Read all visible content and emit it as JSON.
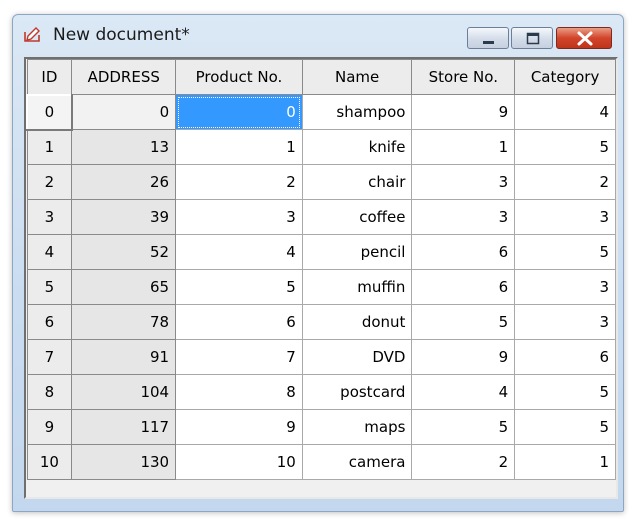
{
  "window": {
    "title": "New document*",
    "controls": {
      "minimize": "minimize",
      "maximize": "maximize",
      "close": "close"
    }
  },
  "table": {
    "columns": [
      "ID",
      "ADDRESS",
      "Product No.",
      "Name",
      "Store No.",
      "Category"
    ],
    "rows": [
      [
        "0",
        "0",
        "0",
        "shampoo",
        "9",
        "4"
      ],
      [
        "1",
        "13",
        "1",
        "knife",
        "1",
        "5"
      ],
      [
        "2",
        "26",
        "2",
        "chair",
        "3",
        "2"
      ],
      [
        "3",
        "39",
        "3",
        "coffee",
        "3",
        "3"
      ],
      [
        "4",
        "52",
        "4",
        "pencil",
        "6",
        "5"
      ],
      [
        "5",
        "65",
        "5",
        "muffin",
        "6",
        "3"
      ],
      [
        "6",
        "78",
        "6",
        "donut",
        "5",
        "3"
      ],
      [
        "7",
        "91",
        "7",
        "DVD",
        "9",
        "6"
      ],
      [
        "8",
        "104",
        "8",
        "postcard",
        "4",
        "5"
      ],
      [
        "9",
        "117",
        "9",
        "maps",
        "5",
        "5"
      ],
      [
        "10",
        "130",
        "10",
        "camera",
        "2",
        "1"
      ]
    ],
    "selected_cell": {
      "row": 0,
      "column": "Product No."
    }
  },
  "colors": {
    "selection": "#3399ff",
    "close_button": "#c9402a",
    "title_bar": "#cfdff1"
  },
  "icons": {
    "app": "document-edit-icon"
  }
}
